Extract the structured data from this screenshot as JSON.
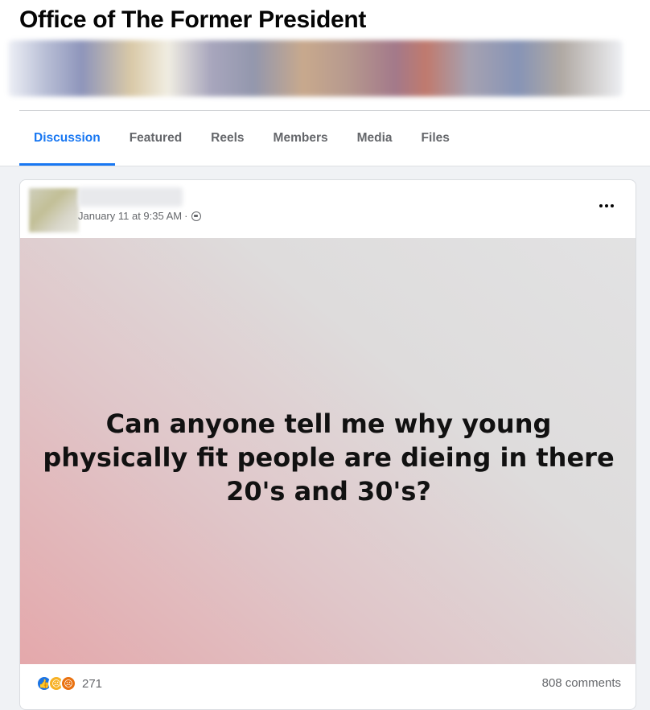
{
  "group": {
    "title": "Office of The Former President"
  },
  "tabs": [
    {
      "label": "Discussion",
      "active": true
    },
    {
      "label": "Featured"
    },
    {
      "label": "Reels"
    },
    {
      "label": "Members"
    },
    {
      "label": "Media"
    },
    {
      "label": "Files"
    }
  ],
  "post": {
    "timestamp": "January 11 at 9:35 AM",
    "separator": "·",
    "privacy_icon": "globe-icon",
    "text": "Can anyone tell me why young physically fit people are dieing in there 20's and 30's?",
    "reaction_count": "271",
    "comments": "808 comments",
    "reaction_icons": [
      "like-icon",
      "sad-icon",
      "angry-icon"
    ]
  },
  "colors": {
    "accent": "#1877f2",
    "like": "#1b74e4",
    "sad": "#f7b125",
    "angry": "#e9710f"
  }
}
